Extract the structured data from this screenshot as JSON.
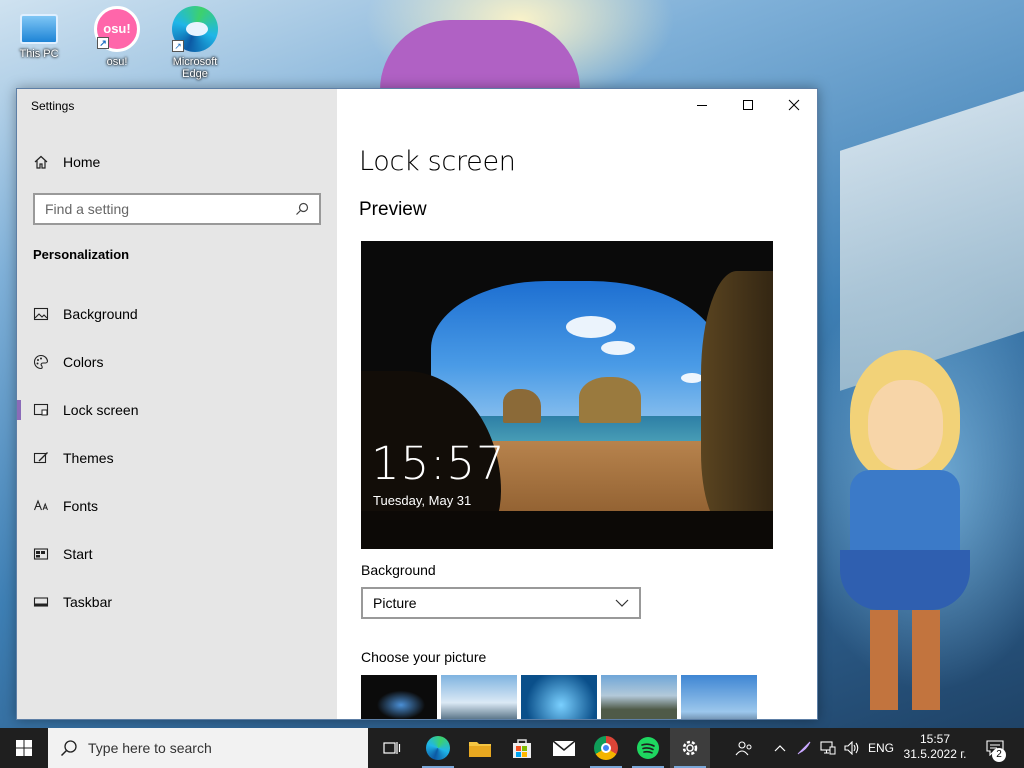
{
  "desktop": {
    "icons": [
      {
        "label": "This PC"
      },
      {
        "label": "osu!",
        "badge": "osu!"
      },
      {
        "label": "Microsoft Edge"
      }
    ]
  },
  "window": {
    "title": "Settings",
    "caption_buttons": [
      "minimize",
      "maximize",
      "close"
    ]
  },
  "sidebar": {
    "home_label": "Home",
    "search_placeholder": "Find a setting",
    "section_title": "Personalization",
    "items": [
      {
        "label": "Background",
        "icon": "picture-icon"
      },
      {
        "label": "Colors",
        "icon": "palette-icon"
      },
      {
        "label": "Lock screen",
        "icon": "lock-screen-icon",
        "active": true
      },
      {
        "label": "Themes",
        "icon": "themes-icon"
      },
      {
        "label": "Fonts",
        "icon": "fonts-icon"
      },
      {
        "label": "Start",
        "icon": "start-icon"
      },
      {
        "label": "Taskbar",
        "icon": "taskbar-icon"
      }
    ]
  },
  "content": {
    "page_title": "Lock screen",
    "preview_heading": "Preview",
    "preview_time": "15:57",
    "preview_date": "Tuesday, May 31",
    "background_label": "Background",
    "background_value": "Picture",
    "choose_picture_label": "Choose your picture"
  },
  "taskbar": {
    "search_placeholder": "Type here to search",
    "pinned": [
      "task-view",
      "edge",
      "file-explorer",
      "microsoft-store",
      "mail",
      "chrome",
      "spotify",
      "settings"
    ],
    "tray": {
      "language": "ENG",
      "time": "15:57",
      "date": "31.5.2022 г.",
      "notification_count": "2"
    }
  },
  "colors": {
    "accent": "#8a6bb8",
    "sidebar_bg": "#e6e6e6",
    "taskbar_bg": "#1f1f1f"
  }
}
